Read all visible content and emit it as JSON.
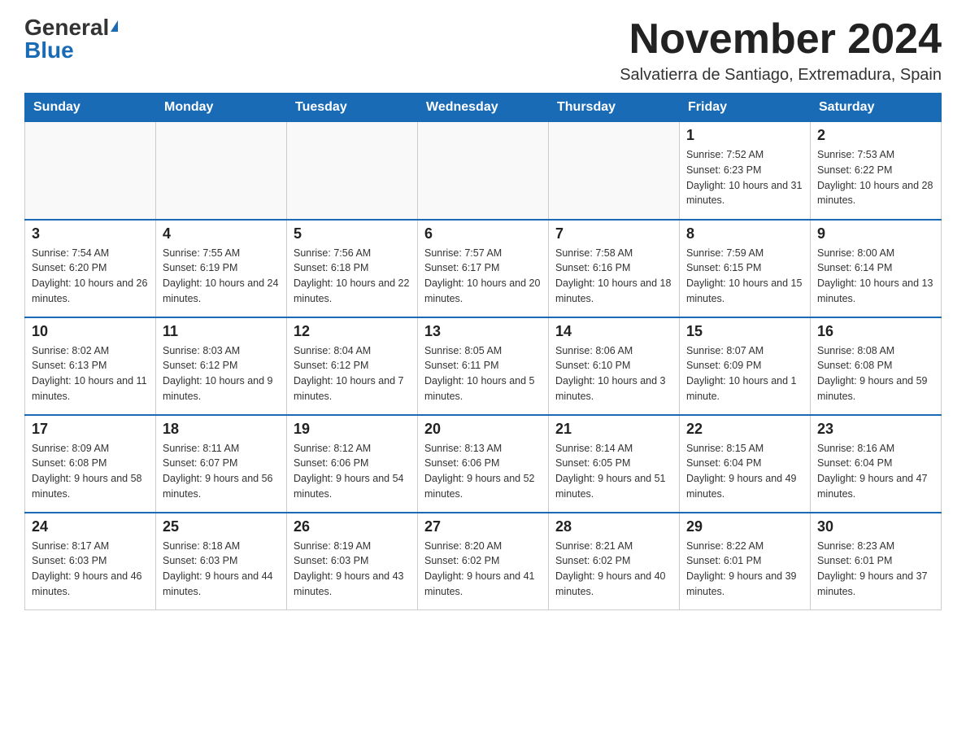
{
  "logo": {
    "general": "General",
    "blue": "Blue"
  },
  "title": "November 2024",
  "location": "Salvatierra de Santiago, Extremadura, Spain",
  "days_of_week": [
    "Sunday",
    "Monday",
    "Tuesday",
    "Wednesday",
    "Thursday",
    "Friday",
    "Saturday"
  ],
  "weeks": [
    [
      {
        "day": "",
        "info": ""
      },
      {
        "day": "",
        "info": ""
      },
      {
        "day": "",
        "info": ""
      },
      {
        "day": "",
        "info": ""
      },
      {
        "day": "",
        "info": ""
      },
      {
        "day": "1",
        "info": "Sunrise: 7:52 AM\nSunset: 6:23 PM\nDaylight: 10 hours and 31 minutes."
      },
      {
        "day": "2",
        "info": "Sunrise: 7:53 AM\nSunset: 6:22 PM\nDaylight: 10 hours and 28 minutes."
      }
    ],
    [
      {
        "day": "3",
        "info": "Sunrise: 7:54 AM\nSunset: 6:20 PM\nDaylight: 10 hours and 26 minutes."
      },
      {
        "day": "4",
        "info": "Sunrise: 7:55 AM\nSunset: 6:19 PM\nDaylight: 10 hours and 24 minutes."
      },
      {
        "day": "5",
        "info": "Sunrise: 7:56 AM\nSunset: 6:18 PM\nDaylight: 10 hours and 22 minutes."
      },
      {
        "day": "6",
        "info": "Sunrise: 7:57 AM\nSunset: 6:17 PM\nDaylight: 10 hours and 20 minutes."
      },
      {
        "day": "7",
        "info": "Sunrise: 7:58 AM\nSunset: 6:16 PM\nDaylight: 10 hours and 18 minutes."
      },
      {
        "day": "8",
        "info": "Sunrise: 7:59 AM\nSunset: 6:15 PM\nDaylight: 10 hours and 15 minutes."
      },
      {
        "day": "9",
        "info": "Sunrise: 8:00 AM\nSunset: 6:14 PM\nDaylight: 10 hours and 13 minutes."
      }
    ],
    [
      {
        "day": "10",
        "info": "Sunrise: 8:02 AM\nSunset: 6:13 PM\nDaylight: 10 hours and 11 minutes."
      },
      {
        "day": "11",
        "info": "Sunrise: 8:03 AM\nSunset: 6:12 PM\nDaylight: 10 hours and 9 minutes."
      },
      {
        "day": "12",
        "info": "Sunrise: 8:04 AM\nSunset: 6:12 PM\nDaylight: 10 hours and 7 minutes."
      },
      {
        "day": "13",
        "info": "Sunrise: 8:05 AM\nSunset: 6:11 PM\nDaylight: 10 hours and 5 minutes."
      },
      {
        "day": "14",
        "info": "Sunrise: 8:06 AM\nSunset: 6:10 PM\nDaylight: 10 hours and 3 minutes."
      },
      {
        "day": "15",
        "info": "Sunrise: 8:07 AM\nSunset: 6:09 PM\nDaylight: 10 hours and 1 minute."
      },
      {
        "day": "16",
        "info": "Sunrise: 8:08 AM\nSunset: 6:08 PM\nDaylight: 9 hours and 59 minutes."
      }
    ],
    [
      {
        "day": "17",
        "info": "Sunrise: 8:09 AM\nSunset: 6:08 PM\nDaylight: 9 hours and 58 minutes."
      },
      {
        "day": "18",
        "info": "Sunrise: 8:11 AM\nSunset: 6:07 PM\nDaylight: 9 hours and 56 minutes."
      },
      {
        "day": "19",
        "info": "Sunrise: 8:12 AM\nSunset: 6:06 PM\nDaylight: 9 hours and 54 minutes."
      },
      {
        "day": "20",
        "info": "Sunrise: 8:13 AM\nSunset: 6:06 PM\nDaylight: 9 hours and 52 minutes."
      },
      {
        "day": "21",
        "info": "Sunrise: 8:14 AM\nSunset: 6:05 PM\nDaylight: 9 hours and 51 minutes."
      },
      {
        "day": "22",
        "info": "Sunrise: 8:15 AM\nSunset: 6:04 PM\nDaylight: 9 hours and 49 minutes."
      },
      {
        "day": "23",
        "info": "Sunrise: 8:16 AM\nSunset: 6:04 PM\nDaylight: 9 hours and 47 minutes."
      }
    ],
    [
      {
        "day": "24",
        "info": "Sunrise: 8:17 AM\nSunset: 6:03 PM\nDaylight: 9 hours and 46 minutes."
      },
      {
        "day": "25",
        "info": "Sunrise: 8:18 AM\nSunset: 6:03 PM\nDaylight: 9 hours and 44 minutes."
      },
      {
        "day": "26",
        "info": "Sunrise: 8:19 AM\nSunset: 6:03 PM\nDaylight: 9 hours and 43 minutes."
      },
      {
        "day": "27",
        "info": "Sunrise: 8:20 AM\nSunset: 6:02 PM\nDaylight: 9 hours and 41 minutes."
      },
      {
        "day": "28",
        "info": "Sunrise: 8:21 AM\nSunset: 6:02 PM\nDaylight: 9 hours and 40 minutes."
      },
      {
        "day": "29",
        "info": "Sunrise: 8:22 AM\nSunset: 6:01 PM\nDaylight: 9 hours and 39 minutes."
      },
      {
        "day": "30",
        "info": "Sunrise: 8:23 AM\nSunset: 6:01 PM\nDaylight: 9 hours and 37 minutes."
      }
    ]
  ]
}
